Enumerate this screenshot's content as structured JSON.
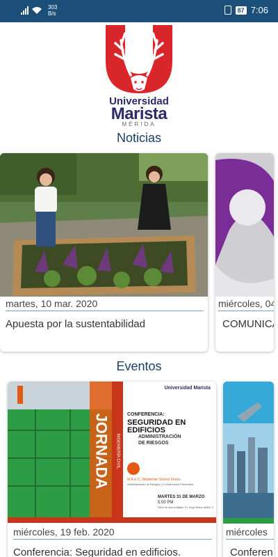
{
  "status_bar": {
    "net_speed_value": "303",
    "net_speed_unit": "B/s",
    "battery": "87",
    "time": "7:06"
  },
  "logo": {
    "name_line1": "Universidad",
    "name_line2": "Marista",
    "city": "MÉRIDA"
  },
  "noticias": {
    "heading": "Noticias",
    "cards": [
      {
        "date": "martes, 10 mar. 2020",
        "title": "Apuesta por la sustentabilidad"
      },
      {
        "date": "miércoles, 04",
        "title": "COMUNICA"
      }
    ]
  },
  "eventos": {
    "heading": "Eventos",
    "cards": [
      {
        "date": "miércoles, 19 feb. 2020",
        "title": "Conferencia: Seguridad en edificios.",
        "poster": {
          "banner": "JORNADA",
          "subbanner": "INGENIERÍA CIVIL",
          "brand_small": "Universidad Marista",
          "kicker": "CONFERENCIA:",
          "headline1": "SEGURIDAD EN",
          "headline2": "EDIFICIOS",
          "headline3": "ADMINISTRACIÓN",
          "headline4": "DE RIESGOS",
          "speaker": "M.A.E.C. Waldemar Gómez Flores",
          "speaker_role": "Administración de Riesgos y Construcción Preventiva",
          "when1": "MARTES 31 DE MARZO",
          "when2": "5:00 PM",
          "where": "Salón de usos múltiples \"Dr. Jorge Muñoz Nuñez\" 2, 3 y 11"
        }
      },
      {
        "date": "miércoles",
        "title": "Conferen"
      }
    ]
  },
  "colors": {
    "status_bar": "#1b4f7a",
    "logo_red": "#d9262b",
    "logo_navy": "#2c2a6b",
    "heading": "#1a3f66",
    "divider": "#7aa0bf",
    "purple_ribbon": "#7b2d97",
    "poster_green": "#2e9c44",
    "poster_orange": "#e35a12"
  },
  "icons": [
    "signal-icon",
    "wifi-icon",
    "vibrate-icon",
    "battery-icon"
  ]
}
